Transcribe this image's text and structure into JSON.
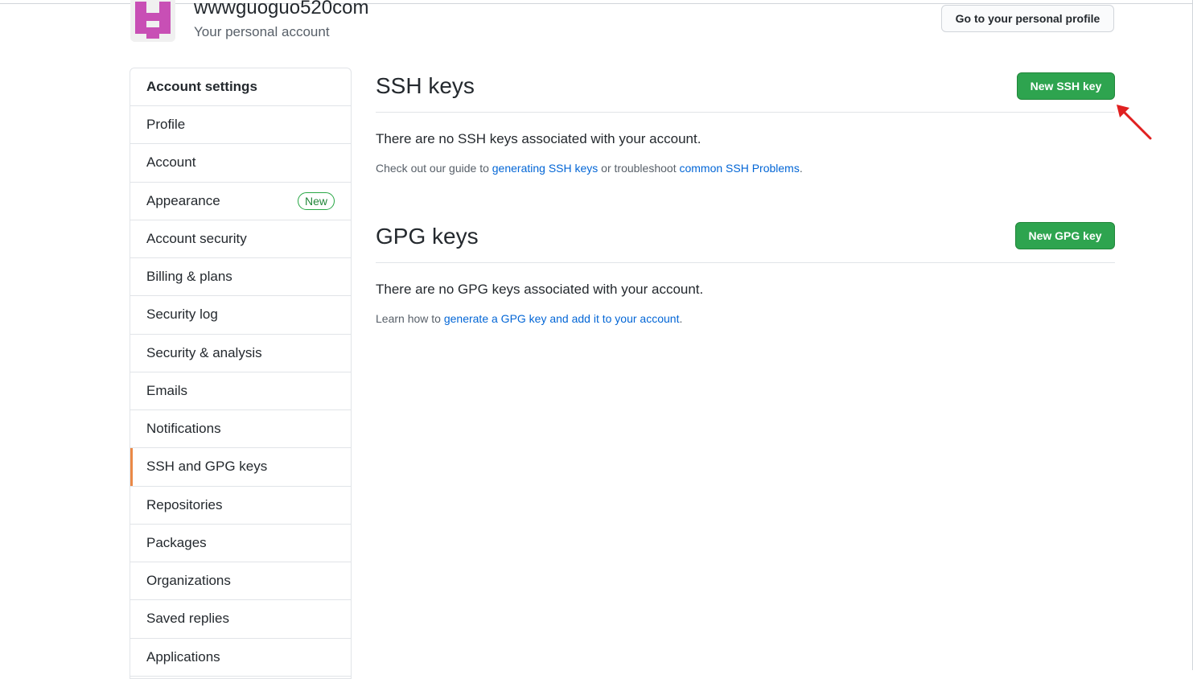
{
  "header": {
    "account_name": "wwwguoguo520com",
    "account_subtitle": "Your personal account",
    "profile_button": "Go to your personal profile"
  },
  "sidebar": {
    "title": "Account settings",
    "items": [
      {
        "label": "Profile"
      },
      {
        "label": "Account"
      },
      {
        "label": "Appearance",
        "badge": "New"
      },
      {
        "label": "Account security"
      },
      {
        "label": "Billing & plans"
      },
      {
        "label": "Security log"
      },
      {
        "label": "Security & analysis"
      },
      {
        "label": "Emails"
      },
      {
        "label": "Notifications"
      },
      {
        "label": "SSH and GPG keys",
        "selected": true
      },
      {
        "label": "Repositories"
      },
      {
        "label": "Packages"
      },
      {
        "label": "Organizations"
      },
      {
        "label": "Saved replies"
      },
      {
        "label": "Applications"
      }
    ]
  },
  "ssh": {
    "title": "SSH keys",
    "button": "New SSH key",
    "empty": "There are no SSH keys associated with your account.",
    "help_prefix": "Check out our guide to ",
    "help_link1": "generating SSH keys",
    "help_middle": " or troubleshoot ",
    "help_link2": "common SSH Problems",
    "help_suffix": "."
  },
  "gpg": {
    "title": "GPG keys",
    "button": "New GPG key",
    "empty": "There are no GPG keys associated with your account.",
    "help_prefix": "Learn how to ",
    "help_link": "generate a GPG key and add it to your account",
    "help_suffix": "."
  },
  "colors": {
    "primary_green": "#2ea44f",
    "link_blue": "#0366d6",
    "selected_indicator": "#e36209",
    "annotation_arrow": "#e02020",
    "avatar_pink": "#c84fb5"
  },
  "icons": {
    "avatar": "identicon-avatar",
    "annotation": "red-arrow-annotation"
  }
}
